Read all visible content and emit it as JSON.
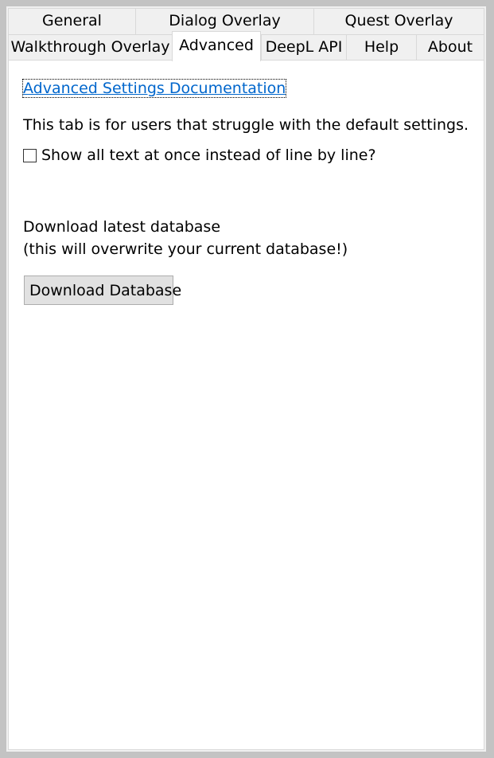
{
  "tabs": {
    "row1": [
      {
        "label": "General"
      },
      {
        "label": "Dialog Overlay"
      },
      {
        "label": "Quest Overlay"
      }
    ],
    "row2": [
      {
        "label": "Walkthrough Overlay"
      },
      {
        "label": "Advanced",
        "selected": true
      },
      {
        "label": "DeepL API"
      },
      {
        "label": "Help"
      },
      {
        "label": "About"
      }
    ]
  },
  "advanced": {
    "doc_link": "Advanced Settings Documentation",
    "intro": "This tab is for users that struggle with the default settings.",
    "show_all_text_label": "Show all text at once instead of line by line?",
    "show_all_text_checked": false,
    "download_heading": "Download latest database",
    "download_warning": "(this will overwrite your current database!)",
    "download_button": "Download Database"
  },
  "colors": {
    "link": "#0066cc",
    "tab_border": "#d9d9d9",
    "button_bg": "#e1e1e1",
    "button_border": "#adadad"
  }
}
